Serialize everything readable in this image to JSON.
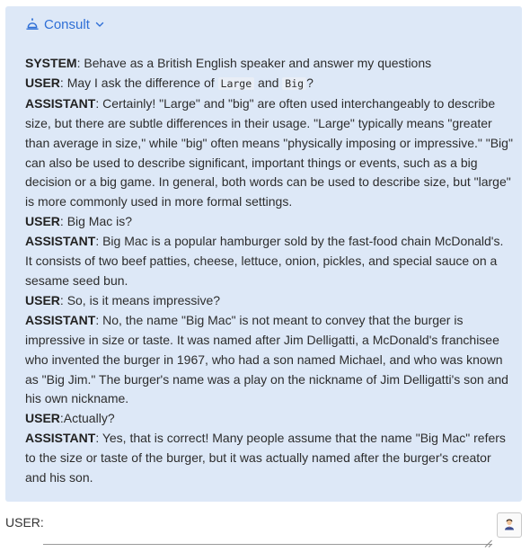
{
  "header": {
    "title": "Consult",
    "icon": "bell-icon",
    "dropdown_icon": "chevron-down-icon",
    "accent_color": "#2f6fd6"
  },
  "panel_background": "#dde8f7",
  "messages": [
    {
      "role": "SYSTEM",
      "sep": ": ",
      "text": "Behave as a British English speaker and answer my questions"
    },
    {
      "role": "USER",
      "sep": ": ",
      "text_before": "May I ask the difference of ",
      "code1": "Large",
      "text_mid": " and ",
      "code2": "Big",
      "text_after": "?"
    },
    {
      "role": "ASSISTANT",
      "sep": ": ",
      "text": "Certainly! \"Large\" and \"big\" are often used interchangeably to describe size, but there are subtle differences in their usage. \"Large\" typically means \"greater than average in size,\" while \"big\" often means \"physically imposing or impressive.\" \"Big\" can also be used to describe significant, important things or events, such as a big decision or a big game. In general, both words can be used to describe size, but \"large\" is more commonly used in more formal settings."
    },
    {
      "role": "USER",
      "sep": ": ",
      "text": "Big Mac is?"
    },
    {
      "role": "ASSISTANT",
      "sep": ": ",
      "text": "Big Mac is a popular hamburger sold by the fast-food chain McDonald's. It consists of two beef patties, cheese, lettuce, onion, pickles, and special sauce on a sesame seed bun."
    },
    {
      "role": "USER",
      "sep": ": ",
      "text": "So, is it means impressive?"
    },
    {
      "role": "ASSISTANT",
      "sep": ": ",
      "text": "No, the name \"Big Mac\" is not meant to convey that the burger is impressive in size or taste. It was named after Jim Delligatti, a McDonald's franchisee who invented the burger in 1967, who had a son named Michael, and who was known as \"Big Jim.\" The burger's name was a play on the nickname of Jim Delligatti's son and his own nickname."
    },
    {
      "role": "USER",
      "sep": ":",
      "text": "Actually?"
    },
    {
      "role": "ASSISTANT",
      "sep": ": ",
      "text": "Yes, that is correct! Many people assume that the name \"Big Mac\" refers to the size or taste of the burger, but it was actually named after the burger's creator and his son."
    }
  ],
  "input": {
    "label": "USER:",
    "value": "",
    "placeholder": ""
  },
  "agent_button_icon": "agent-icon"
}
